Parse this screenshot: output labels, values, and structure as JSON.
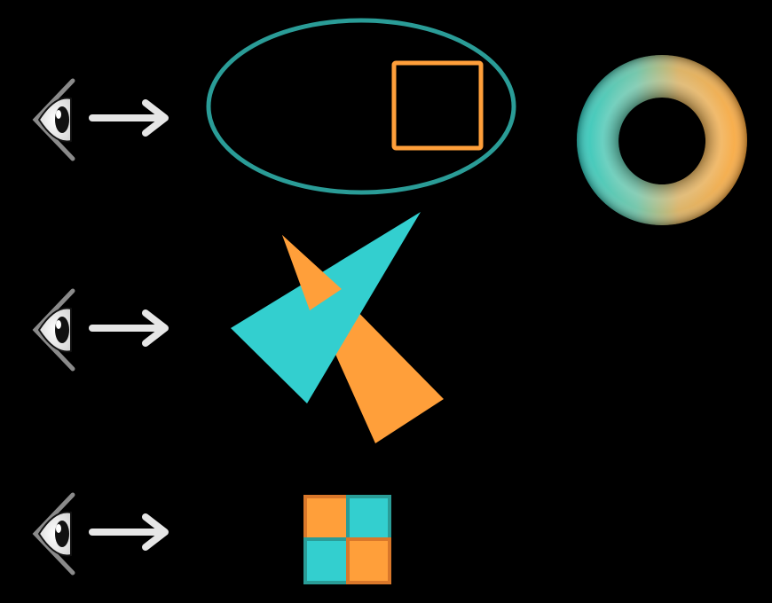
{
  "colors": {
    "background": "#000000",
    "teal": "#2ECFCF",
    "teal_dark": "#2A9C97",
    "orange": "#FF9F3A",
    "orange_dark": "#D9772A",
    "arrow": "#E6E6E6",
    "eye_outline": "#8A8A8A"
  },
  "rows": [
    {
      "viewer": "eye-icon",
      "arrow": "right-arrow-icon",
      "scene": [
        "ellipse-outline",
        "square-outline"
      ],
      "result": "torus"
    },
    {
      "viewer": "eye-icon",
      "arrow": "right-arrow-icon",
      "scene": [
        "teal-triangle",
        "orange-triangle"
      ],
      "result": null
    },
    {
      "viewer": "eye-icon",
      "arrow": "right-arrow-icon",
      "scene": [
        "checker-square"
      ],
      "result": null
    }
  ]
}
